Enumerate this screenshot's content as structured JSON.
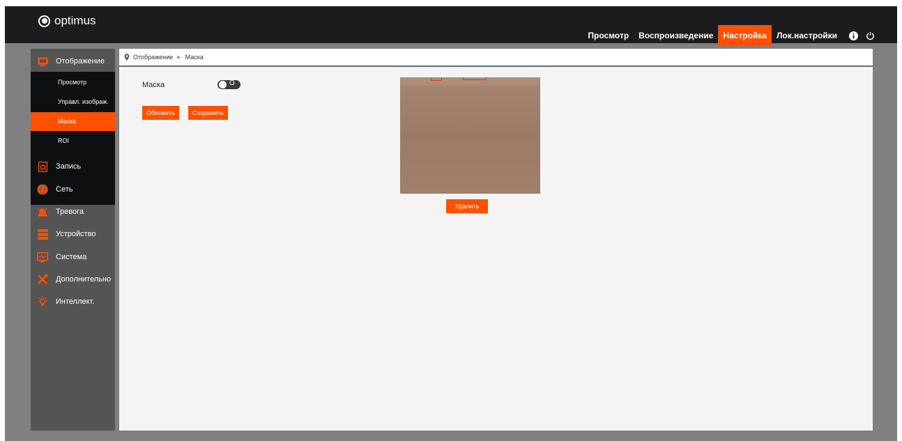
{
  "header": {
    "logo_text": "optimus",
    "nav": [
      {
        "label": "Просмотр",
        "active": false
      },
      {
        "label": "Воспроизведение",
        "active": false
      },
      {
        "label": "Настройка",
        "active": true
      },
      {
        "label": "Лок.настройки",
        "active": false
      }
    ],
    "icons": [
      "info-icon",
      "power-icon"
    ]
  },
  "sidebar": {
    "section": {
      "label": "Отображение",
      "icon": "display-icon"
    },
    "submenu": [
      {
        "label": "Просмотр",
        "active": false
      },
      {
        "label": "Управл. изображ.",
        "active": false
      },
      {
        "label": "Маска",
        "active": true
      },
      {
        "label": "ROI",
        "active": false
      }
    ],
    "items": [
      {
        "label": "Запись",
        "icon": "record-icon"
      },
      {
        "label": "Сеть",
        "icon": "network-icon"
      },
      {
        "label": "Тревога",
        "icon": "alarm-icon"
      },
      {
        "label": "Устройство",
        "icon": "device-icon"
      },
      {
        "label": "Система",
        "icon": "system-icon"
      },
      {
        "label": "Дополнительно",
        "icon": "tools-icon"
      },
      {
        "label": "Интеллект.",
        "icon": "intellect-icon"
      }
    ]
  },
  "breadcrumb": {
    "items": [
      "Отображение",
      "Маска"
    ]
  },
  "main": {
    "mask_label": "Маска",
    "toggle_state": "O",
    "refresh_label": "Обновить",
    "save_label": "Сохранить",
    "delete_label": "Удалить"
  },
  "colors": {
    "accent": "#ff5000",
    "topbar": "#1b1c1e",
    "sidebar": "#545454"
  }
}
